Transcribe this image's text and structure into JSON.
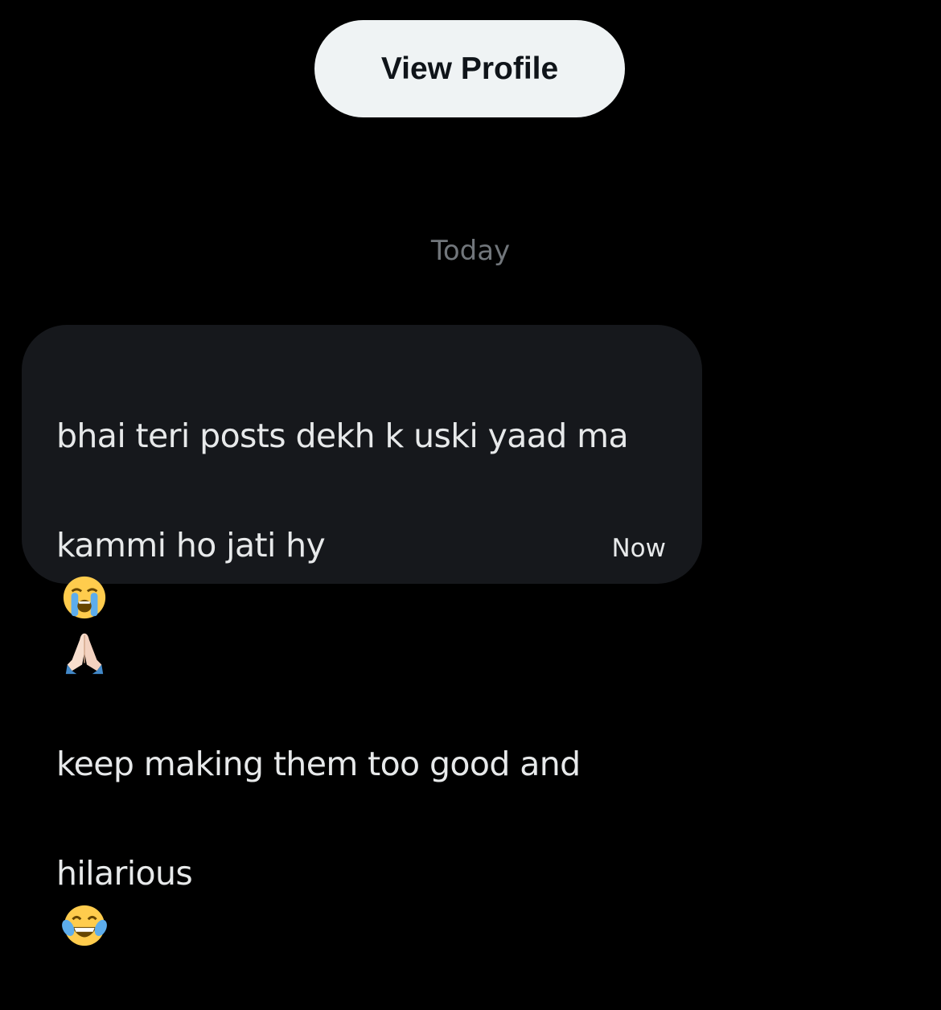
{
  "header": {
    "view_profile_label": "View Profile"
  },
  "conversation": {
    "date_separator": "Today",
    "messages": [
      {
        "lines": [
          "bhai teri posts dekh k uski yaad ma",
          "kammi ho jati hy",
          "keep making them too good and",
          "hilarious"
        ],
        "emojis": {
          "line2": [
            "loudly-crying-face-icon",
            "folded-hands-icon"
          ],
          "line4": [
            "face-with-tears-of-joy-icon"
          ]
        },
        "timestamp": "Now"
      }
    ]
  },
  "colors": {
    "background": "#000000",
    "bubble": "#16181c",
    "button_bg": "#eff3f4",
    "text_primary": "#e7e9ea",
    "text_secondary": "#71767b"
  }
}
